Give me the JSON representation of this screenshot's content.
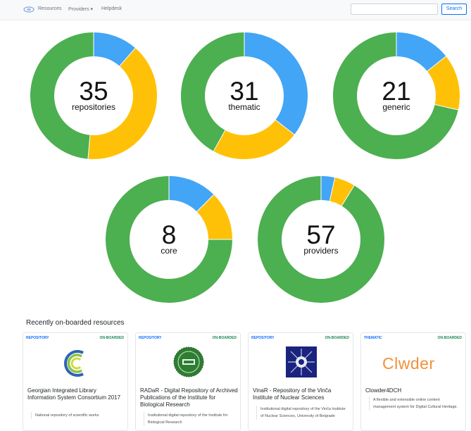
{
  "nav": {
    "items": [
      {
        "label": "Resources"
      },
      {
        "label": "Providers ▾"
      },
      {
        "label": "Helpdesk"
      }
    ],
    "search": {
      "placeholder": "",
      "button_label": "Search"
    }
  },
  "colors": {
    "green": "#4caf50",
    "yellow": "#ffc107",
    "blue": "#42a5f5"
  },
  "chart_data": [
    {
      "type": "pie",
      "title": "",
      "center_value": "35",
      "center_label": "repositories",
      "segments": [
        {
          "color": "#42a5f5",
          "value": 4
        },
        {
          "color": "#ffc107",
          "value": 14
        },
        {
          "color": "#4caf50",
          "value": 17
        }
      ]
    },
    {
      "type": "pie",
      "title": "",
      "center_value": "31",
      "center_label": "thematic",
      "segments": [
        {
          "color": "#42a5f5",
          "value": 11
        },
        {
          "color": "#ffc107",
          "value": 7
        },
        {
          "color": "#4caf50",
          "value": 13
        }
      ]
    },
    {
      "type": "pie",
      "title": "",
      "center_value": "21",
      "center_label": "generic",
      "segments": [
        {
          "color": "#42a5f5",
          "value": 3
        },
        {
          "color": "#ffc107",
          "value": 3
        },
        {
          "color": "#4caf50",
          "value": 15
        }
      ]
    },
    {
      "type": "pie",
      "title": "",
      "center_value": "8",
      "center_label": "core",
      "segments": [
        {
          "color": "#42a5f5",
          "value": 1
        },
        {
          "color": "#ffc107",
          "value": 1
        },
        {
          "color": "#4caf50",
          "value": 6
        }
      ]
    },
    {
      "type": "pie",
      "title": "",
      "center_value": "57",
      "center_label": "providers",
      "segments": [
        {
          "color": "#42a5f5",
          "value": 2
        },
        {
          "color": "#ffc107",
          "value": 3
        },
        {
          "color": "#4caf50",
          "value": 52
        }
      ]
    }
  ],
  "recent": {
    "title": "Recently on-boarded resources",
    "cards": [
      {
        "type": "REPOSITORY",
        "status": "ON-BOARDED",
        "logo": "georgian-library-logo-icon",
        "title": "Georgian Integrated Library Information System Consortium 2017",
        "description": "National repository of scientific works"
      },
      {
        "type": "REPOSITORY",
        "status": "ON-BOARDED",
        "logo": "ibiss-seal-logo-icon",
        "title": "RADaR - Digital Repository of Archived Publications of the Institute for Biological Research",
        "description": "Institutional digital repository of the Institute for Biological Research"
      },
      {
        "type": "REPOSITORY",
        "status": "ON-BOARDED",
        "logo": "vinca-institute-logo-icon",
        "title": "VinaR - Repository of the Vinča Institute of Nuclear Sciences",
        "description": "Institutional digital repository of the Vinča Institute of Nuclear Sciences, University of Belgrade"
      },
      {
        "type": "THEMATIC",
        "status": "ON-BOARDED",
        "logo_text": "Clwder",
        "title": "Clowder4DCH",
        "description": "A flexible and extensible online content management system for Digital Cultural Heritage."
      }
    ]
  }
}
